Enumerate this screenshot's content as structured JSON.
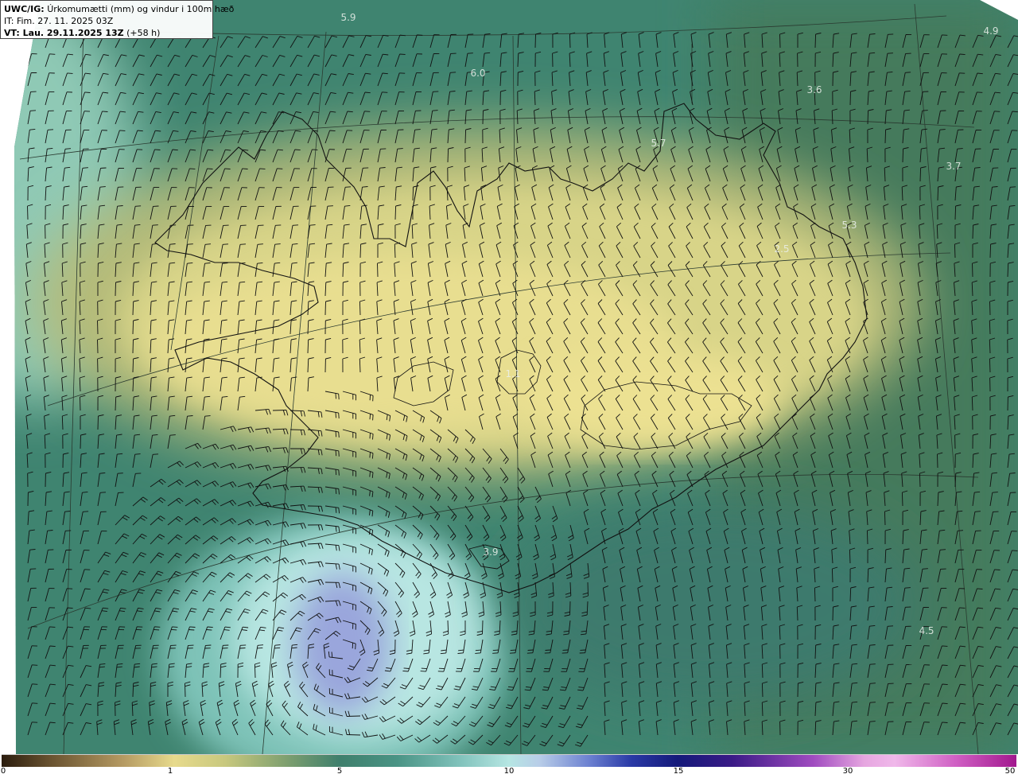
{
  "header": {
    "line1_prefix": "UWC/IG:",
    "line1_text": "Úrkomumætti (mm) og vindur i 100m hæð",
    "line2": "IT: Fim. 27. 11. 2025 03Z",
    "line3_prefix": "VT: Lau. 29.11.2025 13Z",
    "line3_suffix": "(+58 h)"
  },
  "map_labels": [
    "5.9",
    "4.9",
    "6.0",
    "3.6",
    "5.7",
    "3.7",
    "5.3",
    "2.5",
    "1.1",
    "3.9",
    "4.5"
  ],
  "colorbar": {
    "ticks": [
      "0",
      "1",
      "5",
      "10",
      "15",
      "30",
      "50"
    ]
  },
  "colors": {
    "land_low": "#e8dd8e",
    "sea_mid": "#3f8470",
    "sea_light": "#9fd8d3",
    "max_blue": "#8c9ad8",
    "coastline": "#111111",
    "barb": "#111111"
  }
}
